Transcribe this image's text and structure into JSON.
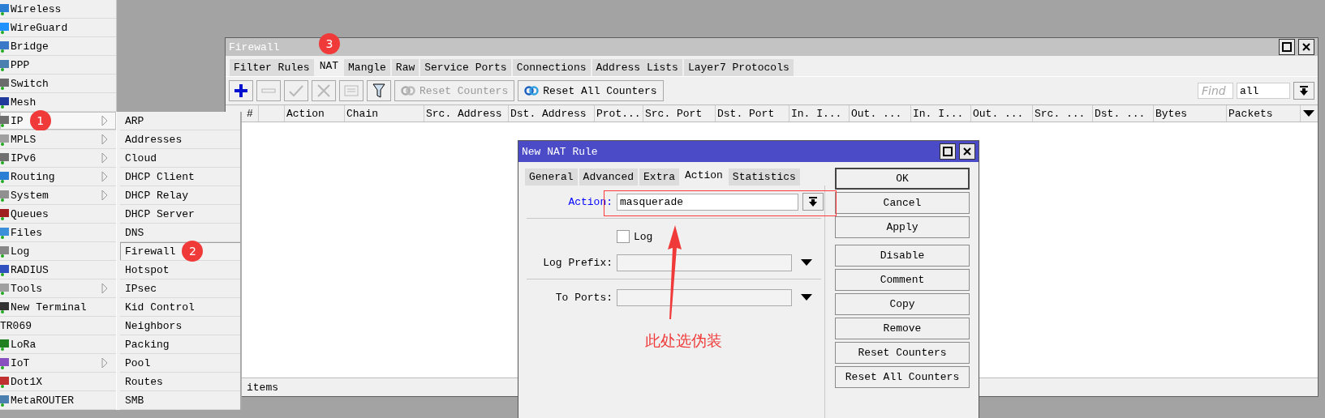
{
  "left_menu": {
    "items": [
      {
        "label": "Wireless",
        "submenu": false,
        "selected": false,
        "has_icon": true
      },
      {
        "label": "WireGuard",
        "submenu": false,
        "selected": false,
        "has_icon": true
      },
      {
        "label": "Bridge",
        "submenu": false,
        "selected": false,
        "has_icon": true
      },
      {
        "label": "PPP",
        "submenu": false,
        "selected": false,
        "has_icon": true
      },
      {
        "label": "Switch",
        "submenu": false,
        "selected": false,
        "has_icon": true
      },
      {
        "label": "Mesh",
        "submenu": false,
        "selected": false,
        "has_icon": true
      },
      {
        "label": "IP",
        "submenu": true,
        "selected": true,
        "has_icon": true,
        "badge": "1"
      },
      {
        "label": "MPLS",
        "submenu": true,
        "selected": false,
        "has_icon": true
      },
      {
        "label": "IPv6",
        "submenu": true,
        "selected": false,
        "has_icon": true
      },
      {
        "label": "Routing",
        "submenu": true,
        "selected": false,
        "has_icon": true
      },
      {
        "label": "System",
        "submenu": true,
        "selected": false,
        "has_icon": true
      },
      {
        "label": "Queues",
        "submenu": false,
        "selected": false,
        "has_icon": true
      },
      {
        "label": "Files",
        "submenu": false,
        "selected": false,
        "has_icon": true
      },
      {
        "label": "Log",
        "submenu": false,
        "selected": false,
        "has_icon": true
      },
      {
        "label": "RADIUS",
        "submenu": false,
        "selected": false,
        "has_icon": true
      },
      {
        "label": "Tools",
        "submenu": true,
        "selected": false,
        "has_icon": true
      },
      {
        "label": "New Terminal",
        "submenu": false,
        "selected": false,
        "has_icon": true
      },
      {
        "label": "TR069",
        "submenu": false,
        "selected": false,
        "has_icon": false
      },
      {
        "label": "LoRa",
        "submenu": false,
        "selected": false,
        "has_icon": true
      },
      {
        "label": "IoT",
        "submenu": true,
        "selected": false,
        "has_icon": true
      },
      {
        "label": "Dot1X",
        "submenu": false,
        "selected": false,
        "has_icon": true
      },
      {
        "label": "MetaROUTER",
        "submenu": false,
        "selected": false,
        "has_icon": true
      }
    ]
  },
  "submenu": {
    "items": [
      {
        "label": "ARP",
        "selected": false
      },
      {
        "label": "Addresses",
        "selected": false
      },
      {
        "label": "Cloud",
        "selected": false
      },
      {
        "label": "DHCP Client",
        "selected": false
      },
      {
        "label": "DHCP Relay",
        "selected": false
      },
      {
        "label": "DHCP Server",
        "selected": false
      },
      {
        "label": "DNS",
        "selected": false
      },
      {
        "label": "Firewall",
        "selected": true,
        "badge": "2"
      },
      {
        "label": "Hotspot",
        "selected": false
      },
      {
        "label": "IPsec",
        "selected": false
      },
      {
        "label": "Kid Control",
        "selected": false
      },
      {
        "label": "Neighbors",
        "selected": false
      },
      {
        "label": "Packing",
        "selected": false
      },
      {
        "label": "Pool",
        "selected": false
      },
      {
        "label": "Routes",
        "selected": false
      },
      {
        "label": "SMB",
        "selected": false
      }
    ]
  },
  "firewall": {
    "title": "Firewall",
    "tabs": [
      {
        "label": "Filter Rules",
        "selected": false
      },
      {
        "label": "NAT",
        "selected": true,
        "badge": "3"
      },
      {
        "label": "Mangle",
        "selected": false
      },
      {
        "label": "Raw",
        "selected": false
      },
      {
        "label": "Service Ports",
        "selected": false
      },
      {
        "label": "Connections",
        "selected": false
      },
      {
        "label": "Address Lists",
        "selected": false
      },
      {
        "label": "Layer7 Protocols",
        "selected": false
      }
    ],
    "toolbar": {
      "icon_buttons": [
        {
          "kind": "add",
          "disabled": false
        },
        {
          "kind": "remove",
          "disabled": true
        },
        {
          "kind": "enable",
          "disabled": true
        },
        {
          "kind": "disable",
          "disabled": true
        },
        {
          "kind": "comment",
          "disabled": true
        },
        {
          "kind": "filter",
          "disabled": false
        }
      ],
      "text_buttons": [
        {
          "label": "Reset Counters",
          "disabled": true
        },
        {
          "label": "Reset All Counters",
          "disabled": false
        }
      ],
      "find": {
        "placeholder": "Find"
      },
      "filter_select": {
        "value": "all"
      }
    },
    "table": {
      "columns": [
        "#",
        "Action",
        "Chain",
        "Src. Address",
        "Dst. Address",
        "Prot...",
        "Src. Port",
        "Dst. Port",
        "In. I...",
        "Out. ...",
        "In. I...",
        "Out. ...",
        "Src. ...",
        "Dst. ...",
        "Bytes",
        "Packets"
      ]
    },
    "status_bar": "items"
  },
  "dialog": {
    "title": "New NAT Rule",
    "tabs": [
      {
        "label": "General",
        "selected": false
      },
      {
        "label": "Advanced",
        "selected": false
      },
      {
        "label": "Extra",
        "selected": false
      },
      {
        "label": "Action",
        "selected": true
      },
      {
        "label": "Statistics",
        "selected": false
      }
    ],
    "action": {
      "label": "Action:",
      "value": "masquerade"
    },
    "log": {
      "label": "Log",
      "checked": false
    },
    "fields": [
      {
        "label": "Log Prefix:"
      },
      {
        "label": "To Ports:"
      }
    ],
    "buttons": [
      {
        "label": "OK",
        "default": true
      },
      {
        "label": "Cancel",
        "default": false
      },
      {
        "label": "Apply",
        "default": false
      },
      {
        "label": "Disable",
        "default": false
      },
      {
        "label": "Comment",
        "default": false
      },
      {
        "label": "Copy",
        "default": false
      },
      {
        "label": "Remove",
        "default": false
      },
      {
        "label": "Reset Counters",
        "default": false
      },
      {
        "label": "Reset All Counters",
        "default": false
      }
    ]
  },
  "annotation": {
    "text": "此处选伪装"
  }
}
